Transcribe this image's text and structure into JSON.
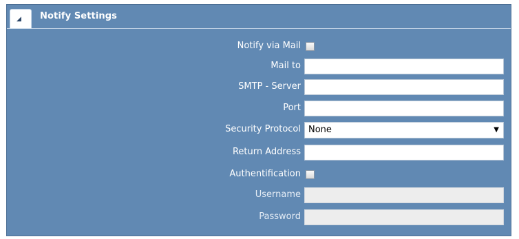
{
  "panel": {
    "title": "Notify Settings",
    "collapse_glyph": "◢"
  },
  "form": {
    "notify_via_mail": {
      "label": "Notify via Mail",
      "checked": false
    },
    "mail_to": {
      "label": "Mail to",
      "value": ""
    },
    "smtp_server": {
      "label": "SMTP - Server",
      "value": ""
    },
    "port": {
      "label": "Port",
      "value": ""
    },
    "security_protocol": {
      "label": "Security Protocol",
      "value": "None",
      "arrow": "▼"
    },
    "return_address": {
      "label": "Return Address",
      "value": ""
    },
    "authentification": {
      "label": "Authentification",
      "checked": false
    },
    "username": {
      "label": "Username",
      "value": "",
      "disabled": true
    },
    "password": {
      "label": "Password",
      "value": "",
      "disabled": true
    }
  },
  "colors": {
    "panel_background": "#6189b3",
    "field_background": "#ffffff",
    "disabled_field_background": "#ededed"
  }
}
